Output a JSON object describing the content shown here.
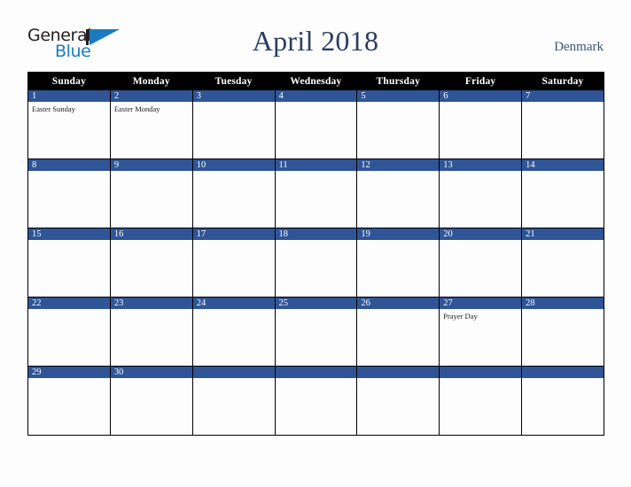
{
  "brand": {
    "word_primary": "General",
    "word_secondary": "Blue",
    "mark_icon": "triangle-logo-icon",
    "primary_color": "#231f20",
    "secondary_color": "#1a7bc0"
  },
  "header": {
    "title": "April 2018",
    "country": "Denmark",
    "title_color": "#2b3d63",
    "country_color": "#3c5275"
  },
  "calendar": {
    "month": "April",
    "year": "2018",
    "accent_color": "#2f5597",
    "header_background": "#000000",
    "day_names": [
      "Sunday",
      "Monday",
      "Tuesday",
      "Wednesday",
      "Thursday",
      "Friday",
      "Saturday"
    ],
    "weeks": [
      [
        {
          "date": "1",
          "events": [
            "Easter Sunday"
          ]
        },
        {
          "date": "2",
          "events": [
            "Easter Monday"
          ]
        },
        {
          "date": "3",
          "events": []
        },
        {
          "date": "4",
          "events": []
        },
        {
          "date": "5",
          "events": []
        },
        {
          "date": "6",
          "events": []
        },
        {
          "date": "7",
          "events": []
        }
      ],
      [
        {
          "date": "8",
          "events": []
        },
        {
          "date": "9",
          "events": []
        },
        {
          "date": "10",
          "events": []
        },
        {
          "date": "11",
          "events": []
        },
        {
          "date": "12",
          "events": []
        },
        {
          "date": "13",
          "events": []
        },
        {
          "date": "14",
          "events": []
        }
      ],
      [
        {
          "date": "15",
          "events": []
        },
        {
          "date": "16",
          "events": []
        },
        {
          "date": "17",
          "events": []
        },
        {
          "date": "18",
          "events": []
        },
        {
          "date": "19",
          "events": []
        },
        {
          "date": "20",
          "events": []
        },
        {
          "date": "21",
          "events": []
        }
      ],
      [
        {
          "date": "22",
          "events": []
        },
        {
          "date": "23",
          "events": []
        },
        {
          "date": "24",
          "events": []
        },
        {
          "date": "25",
          "events": []
        },
        {
          "date": "26",
          "events": []
        },
        {
          "date": "27",
          "events": [
            "Prayer Day"
          ]
        },
        {
          "date": "28",
          "events": []
        }
      ],
      [
        {
          "date": "29",
          "events": []
        },
        {
          "date": "30",
          "events": []
        },
        {
          "date": "",
          "events": []
        },
        {
          "date": "",
          "events": []
        },
        {
          "date": "",
          "events": []
        },
        {
          "date": "",
          "events": []
        },
        {
          "date": "",
          "events": []
        }
      ]
    ]
  }
}
